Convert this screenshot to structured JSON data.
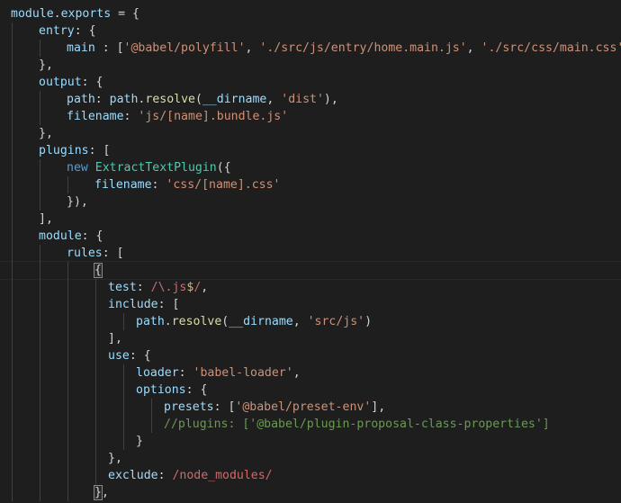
{
  "editor": {
    "language": "javascript",
    "theme_colors": {
      "background": "#1e1e1e",
      "keyword": "#569cd6",
      "property": "#9cdcfe",
      "string": "#ce9178",
      "function": "#dcdcaa",
      "class": "#4ec9b0",
      "regex": "#d16969",
      "comment": "#6a9955",
      "punctuation": "#d4d4d4"
    },
    "current_line": 15,
    "lines": [
      {
        "indent": 0,
        "tokens": [
          [
            "prop",
            "module"
          ],
          [
            "punc",
            "."
          ],
          [
            "prop",
            "exports"
          ],
          [
            "punc",
            " = {"
          ]
        ]
      },
      {
        "indent": 1,
        "tokens": [
          [
            "prop",
            "entry"
          ],
          [
            "punc",
            ": {"
          ]
        ]
      },
      {
        "indent": 2,
        "tokens": [
          [
            "prop",
            "main"
          ],
          [
            "punc",
            " : ["
          ],
          [
            "str",
            "'@babel/polyfill'"
          ],
          [
            "punc",
            ", "
          ],
          [
            "str",
            "'./src/js/entry/home.main.js'"
          ],
          [
            "punc",
            ", "
          ],
          [
            "str",
            "'./src/css/main.css'"
          ],
          [
            "punc",
            "]"
          ]
        ]
      },
      {
        "indent": 1,
        "tokens": [
          [
            "punc",
            "},"
          ]
        ]
      },
      {
        "indent": 1,
        "tokens": [
          [
            "prop",
            "output"
          ],
          [
            "punc",
            ": {"
          ]
        ]
      },
      {
        "indent": 2,
        "tokens": [
          [
            "prop",
            "path"
          ],
          [
            "punc",
            ": "
          ],
          [
            "prop",
            "path"
          ],
          [
            "punc",
            "."
          ],
          [
            "fn",
            "resolve"
          ],
          [
            "punc",
            "("
          ],
          [
            "prop",
            "__dirname"
          ],
          [
            "punc",
            ", "
          ],
          [
            "str",
            "'dist'"
          ],
          [
            "punc",
            "),"
          ]
        ]
      },
      {
        "indent": 2,
        "tokens": [
          [
            "prop",
            "filename"
          ],
          [
            "punc",
            ": "
          ],
          [
            "str",
            "'js/[name].bundle.js'"
          ]
        ]
      },
      {
        "indent": 1,
        "tokens": [
          [
            "punc",
            "},"
          ]
        ]
      },
      {
        "indent": 1,
        "tokens": [
          [
            "prop",
            "plugins"
          ],
          [
            "punc",
            ": ["
          ]
        ]
      },
      {
        "indent": 2,
        "tokens": [
          [
            "kw",
            "new "
          ],
          [
            "cls",
            "ExtractTextPlugin"
          ],
          [
            "punc",
            "({"
          ]
        ]
      },
      {
        "indent": 3,
        "tokens": [
          [
            "prop",
            "filename"
          ],
          [
            "punc",
            ": "
          ],
          [
            "str",
            "'css/[name].css'"
          ]
        ]
      },
      {
        "indent": 2,
        "tokens": [
          [
            "punc",
            "}),"
          ]
        ]
      },
      {
        "indent": 1,
        "tokens": [
          [
            "punc",
            "],"
          ]
        ]
      },
      {
        "indent": 1,
        "tokens": [
          [
            "prop",
            "module"
          ],
          [
            "punc",
            ": {"
          ]
        ]
      },
      {
        "indent": 2,
        "tokens": [
          [
            "prop",
            "rules"
          ],
          [
            "punc",
            ": ["
          ]
        ]
      },
      {
        "indent": 3,
        "tokens": [
          [
            "match",
            "{"
          ]
        ]
      },
      {
        "indent": 3,
        "extra": 1,
        "tokens": [
          [
            "prop",
            "test"
          ],
          [
            "punc",
            ": "
          ],
          [
            "re",
            "/\\."
          ],
          [
            "re",
            "js"
          ],
          [
            "recls",
            "$"
          ],
          [
            "re",
            "/"
          ],
          [
            "punc",
            ","
          ]
        ]
      },
      {
        "indent": 3,
        "extra": 1,
        "tokens": [
          [
            "prop",
            "include"
          ],
          [
            "punc",
            ": ["
          ]
        ]
      },
      {
        "indent": 4,
        "extra": 1,
        "tokens": [
          [
            "prop",
            "path"
          ],
          [
            "punc",
            "."
          ],
          [
            "fn",
            "resolve"
          ],
          [
            "punc",
            "("
          ],
          [
            "prop",
            "__dirname"
          ],
          [
            "punc",
            ", "
          ],
          [
            "str",
            "'src/js'"
          ],
          [
            "punc",
            ")"
          ]
        ]
      },
      {
        "indent": 3,
        "extra": 1,
        "tokens": [
          [
            "punc",
            "],"
          ]
        ]
      },
      {
        "indent": 3,
        "extra": 1,
        "tokens": [
          [
            "prop",
            "use"
          ],
          [
            "punc",
            ": {"
          ]
        ]
      },
      {
        "indent": 4,
        "extra": 1,
        "tokens": [
          [
            "prop",
            "loader"
          ],
          [
            "punc",
            ": "
          ],
          [
            "str",
            "'babel-loader'"
          ],
          [
            "punc",
            ","
          ]
        ]
      },
      {
        "indent": 4,
        "extra": 1,
        "tokens": [
          [
            "prop",
            "options"
          ],
          [
            "punc",
            ": {"
          ]
        ]
      },
      {
        "indent": 5,
        "extra": 1,
        "tokens": [
          [
            "prop",
            "presets"
          ],
          [
            "punc",
            ": ["
          ],
          [
            "str",
            "'@babel/preset-env'"
          ],
          [
            "punc",
            "],"
          ]
        ]
      },
      {
        "indent": 5,
        "extra": 1,
        "tokens": [
          [
            "cmt",
            "//plugins: ['@babel/plugin-proposal-class-properties']"
          ]
        ]
      },
      {
        "indent": 4,
        "extra": 1,
        "tokens": [
          [
            "punc",
            "}"
          ]
        ]
      },
      {
        "indent": 3,
        "extra": 1,
        "tokens": [
          [
            "punc",
            "},"
          ]
        ]
      },
      {
        "indent": 3,
        "extra": 1,
        "tokens": [
          [
            "prop",
            "exclude"
          ],
          [
            "punc",
            ": "
          ],
          [
            "re",
            "/node_modules/"
          ]
        ]
      },
      {
        "indent": 3,
        "tokens": [
          [
            "match",
            "}"
          ],
          [
            "punc",
            ","
          ]
        ]
      }
    ]
  }
}
